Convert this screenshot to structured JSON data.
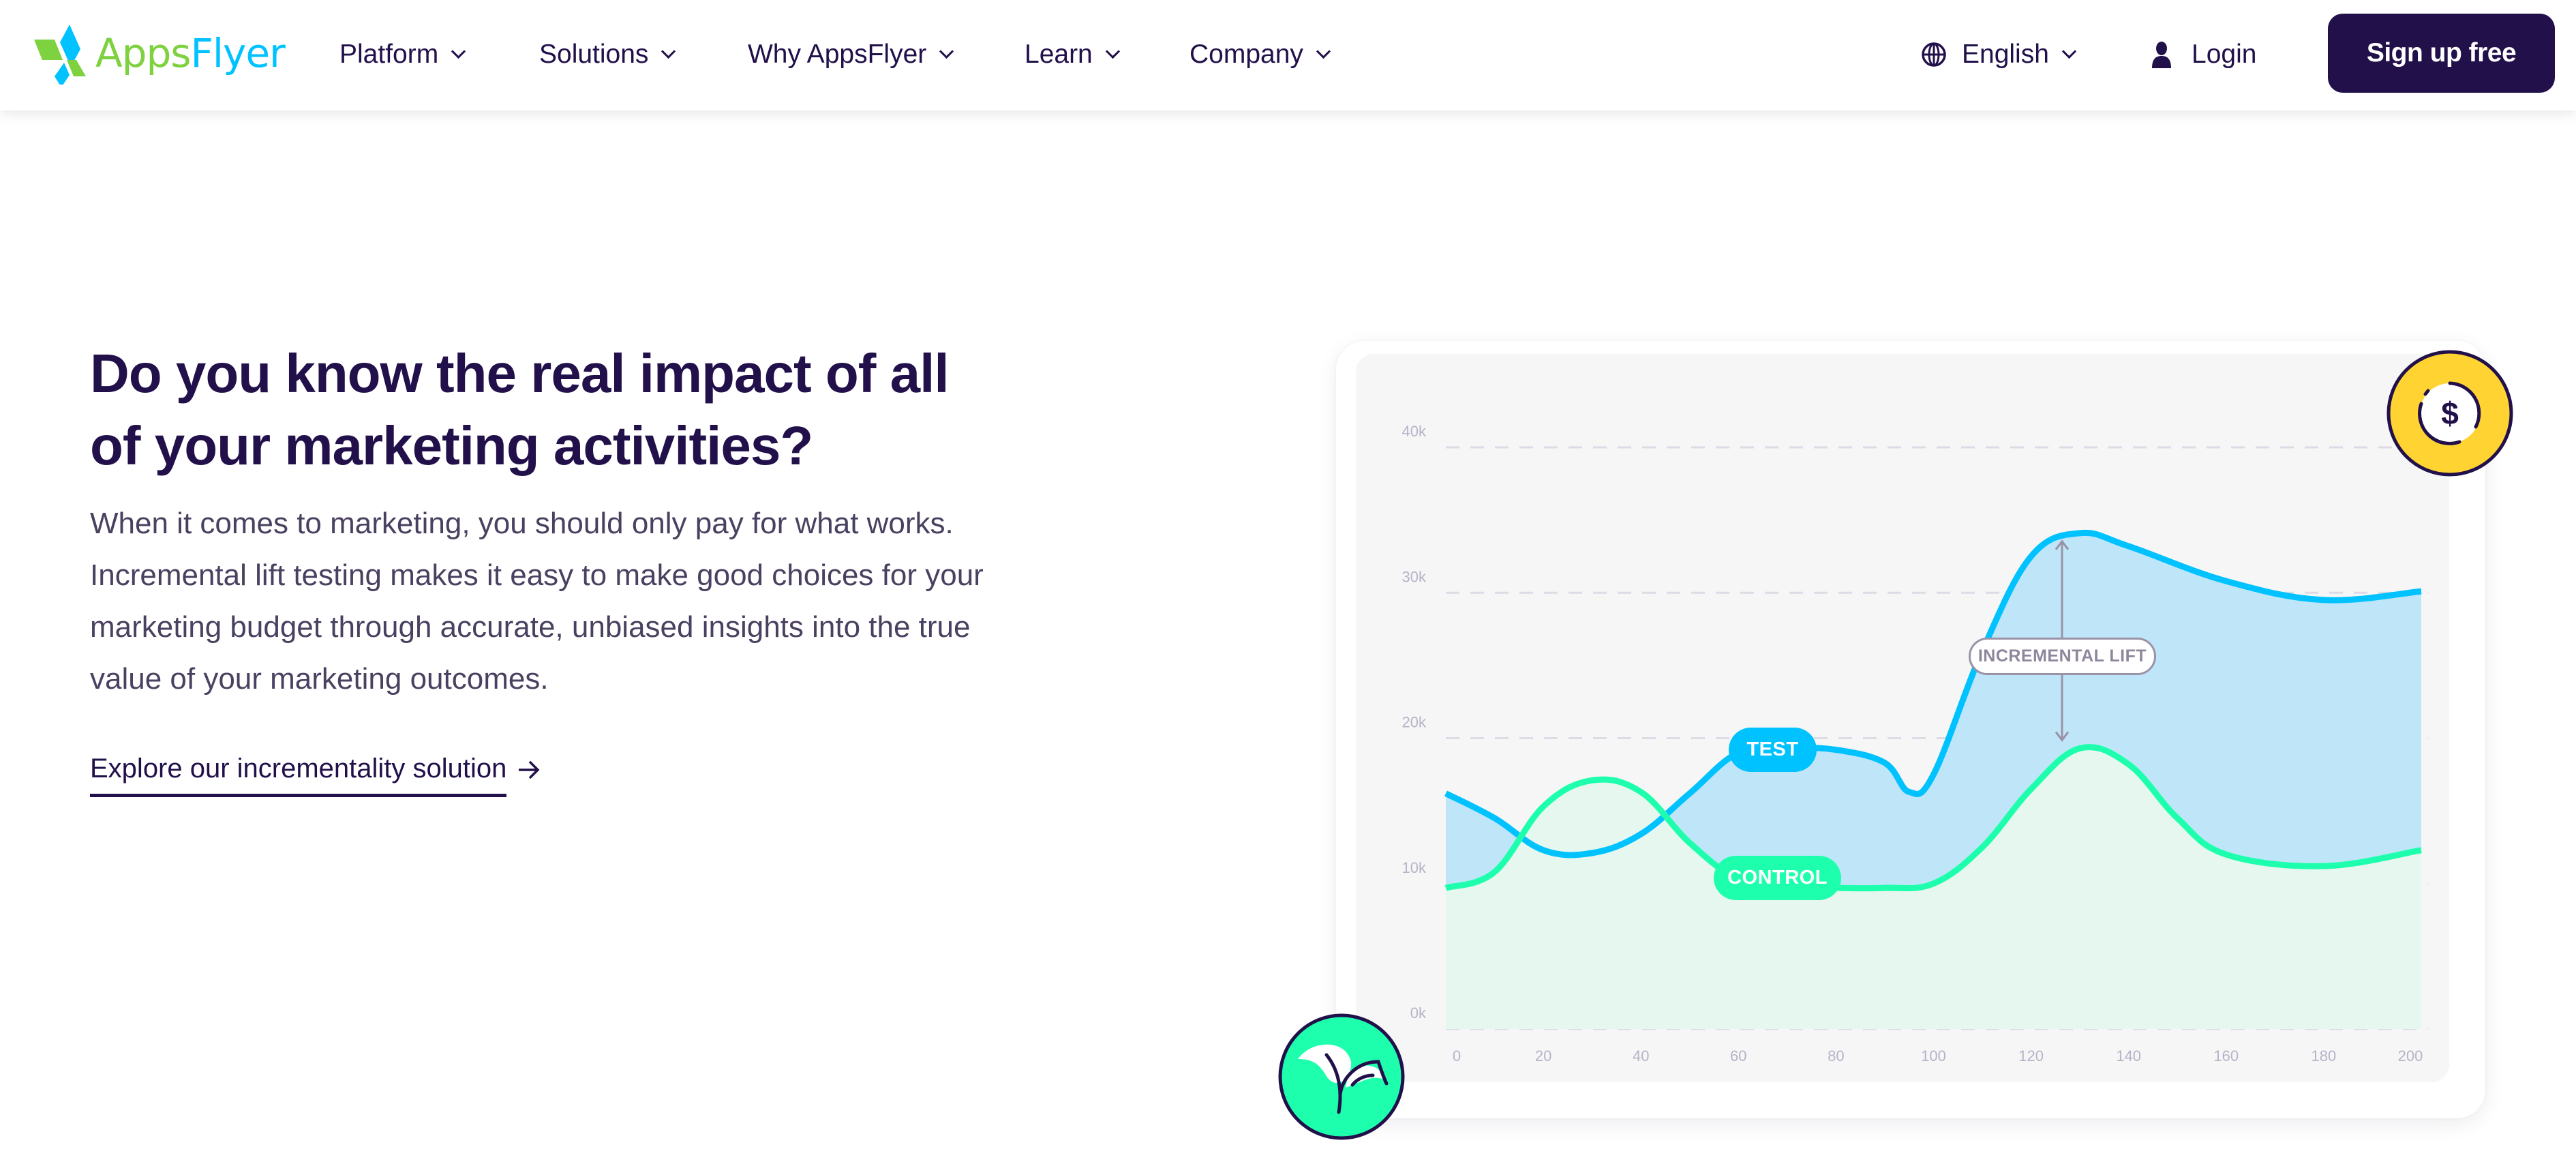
{
  "brand": {
    "logo_part1": "Apps",
    "logo_part2": "Flyer",
    "colors": {
      "primary": "#22104a",
      "green": "#7ed13f",
      "blue": "#00c2ff",
      "mint": "#1effae",
      "yellow": "#ffd432"
    }
  },
  "nav": {
    "items": [
      {
        "label": "Platform",
        "icon": "chevron-down-icon"
      },
      {
        "label": "Solutions",
        "icon": "chevron-down-icon"
      },
      {
        "label": "Why AppsFlyer",
        "icon": "chevron-down-icon"
      },
      {
        "label": "Learn",
        "icon": "chevron-down-icon"
      },
      {
        "label": "Company",
        "icon": "chevron-down-icon"
      }
    ],
    "language": {
      "label": "English",
      "icon": "globe-icon"
    },
    "login": {
      "label": "Login",
      "icon": "user-icon"
    },
    "signup_label": "Sign up free"
  },
  "hero": {
    "title_line1": "Do you know the real impact of all",
    "title_line2": "of your marketing activities?",
    "body_lines": [
      "When it comes to marketing, you should only pay for what works.",
      "Incremental lift testing makes it easy to make good choices for your",
      "marketing budget through accurate, unbiased insights into the true",
      "value of your marketing outcomes."
    ],
    "cta_label": "Explore our incrementality solution",
    "cta_icon": "arrow-right-icon"
  },
  "illustration": {
    "top_icon": "dollar-coin-icon",
    "bottom_icon": "sprout-icon"
  },
  "chart_data": {
    "type": "area",
    "title": "",
    "xlabel": "",
    "ylabel": "",
    "x_ticks": [
      "0",
      "20",
      "40",
      "60",
      "80",
      "100",
      "120",
      "140",
      "160",
      "180",
      "200"
    ],
    "y_ticks": [
      "0k",
      "10k",
      "20k",
      "30k",
      "40k"
    ],
    "xlim": [
      0,
      200
    ],
    "ylim": [
      0,
      40000
    ],
    "grid": true,
    "series": [
      {
        "name": "TEST",
        "color": "#00c2ff",
        "fill": "#bee6f8",
        "x": [
          0,
          10,
          20,
          30,
          40,
          50,
          60,
          70,
          80,
          90,
          95,
          100,
          110,
          120,
          130,
          140,
          160,
          180,
          200
        ],
        "y": [
          16200,
          14500,
          12300,
          12100,
          13400,
          16200,
          19000,
          19300,
          19200,
          18300,
          16300,
          17500,
          26000,
          32500,
          34100,
          33200,
          30800,
          29500,
          30100
        ]
      },
      {
        "name": "CONTROL",
        "color": "#1effae",
        "fill": "#e6f7ef",
        "x": [
          0,
          10,
          20,
          30,
          40,
          50,
          60,
          70,
          80,
          90,
          100,
          110,
          120,
          130,
          140,
          150,
          160,
          180,
          200
        ],
        "y": [
          9700,
          10800,
          15300,
          17100,
          16300,
          12800,
          10300,
          9800,
          9700,
          9700,
          10000,
          12500,
          16500,
          19300,
          18200,
          14500,
          12000,
          11200,
          12300
        ]
      }
    ],
    "annotations": [
      {
        "text": "TEST",
        "series": "TEST",
        "x": 66
      },
      {
        "text": "CONTROL",
        "series": "CONTROL",
        "x": 66
      },
      {
        "text": "INCREMENTAL LIFT",
        "x": 128,
        "from": 19300,
        "to": 34100
      }
    ]
  }
}
